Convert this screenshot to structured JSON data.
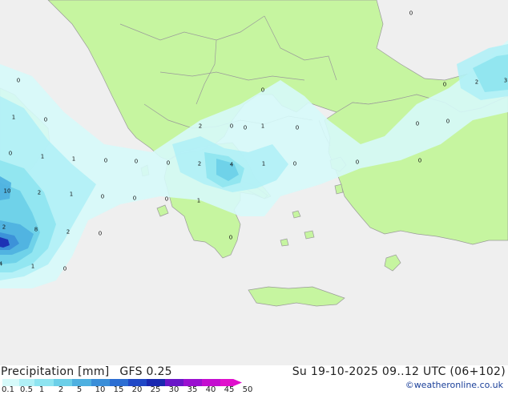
{
  "header": {
    "product": "Precipitation [mm]",
    "model": "GFS 0.25",
    "valid_time": "Su 19-10-2025 09..12 UTC (06+102)",
    "credit": "©weatheronline.co.uk"
  },
  "colors": {
    "sea": "#efefef",
    "land": "#c6f5a0",
    "border": "#9a9a9a"
  },
  "legend": {
    "ticks": [
      "0.1",
      "0.5",
      "1",
      "2",
      "5",
      "10",
      "15",
      "20",
      "25",
      "30",
      "35",
      "40",
      "45",
      "50"
    ],
    "colors": [
      "#d6fafa",
      "#b0f0f6",
      "#8ee4f0",
      "#6ccfe8",
      "#4eb0e0",
      "#3a8ed8",
      "#2c6ed2",
      "#2048c6",
      "#1a28b0",
      "#6a16c8",
      "#9a10d0",
      "#c40ed0",
      "#e010cc"
    ]
  },
  "map_labels": [
    {
      "text": "0"
    },
    {
      "text": "0"
    },
    {
      "text": "1"
    },
    {
      "text": "0"
    },
    {
      "text": "0"
    },
    {
      "text": "1"
    },
    {
      "text": "1"
    },
    {
      "text": "0"
    },
    {
      "text": "0"
    },
    {
      "text": "0"
    },
    {
      "text": "10"
    },
    {
      "text": "2"
    },
    {
      "text": "1"
    },
    {
      "text": "0"
    },
    {
      "text": "0"
    },
    {
      "text": "0"
    },
    {
      "text": "1"
    },
    {
      "text": "2"
    },
    {
      "text": "8"
    },
    {
      "text": "2"
    },
    {
      "text": "0"
    },
    {
      "text": "4"
    },
    {
      "text": "1"
    },
    {
      "text": "0"
    },
    {
      "text": "0"
    },
    {
      "text": "2"
    },
    {
      "text": "4"
    },
    {
      "text": "1"
    },
    {
      "text": "0"
    },
    {
      "text": "0"
    },
    {
      "text": "2"
    },
    {
      "text": "0"
    },
    {
      "text": "1"
    },
    {
      "text": "0"
    },
    {
      "text": "0"
    },
    {
      "text": "0"
    },
    {
      "text": "0"
    },
    {
      "text": "0"
    },
    {
      "text": "0"
    },
    {
      "text": "0"
    },
    {
      "text": "2"
    },
    {
      "text": "3"
    }
  ]
}
